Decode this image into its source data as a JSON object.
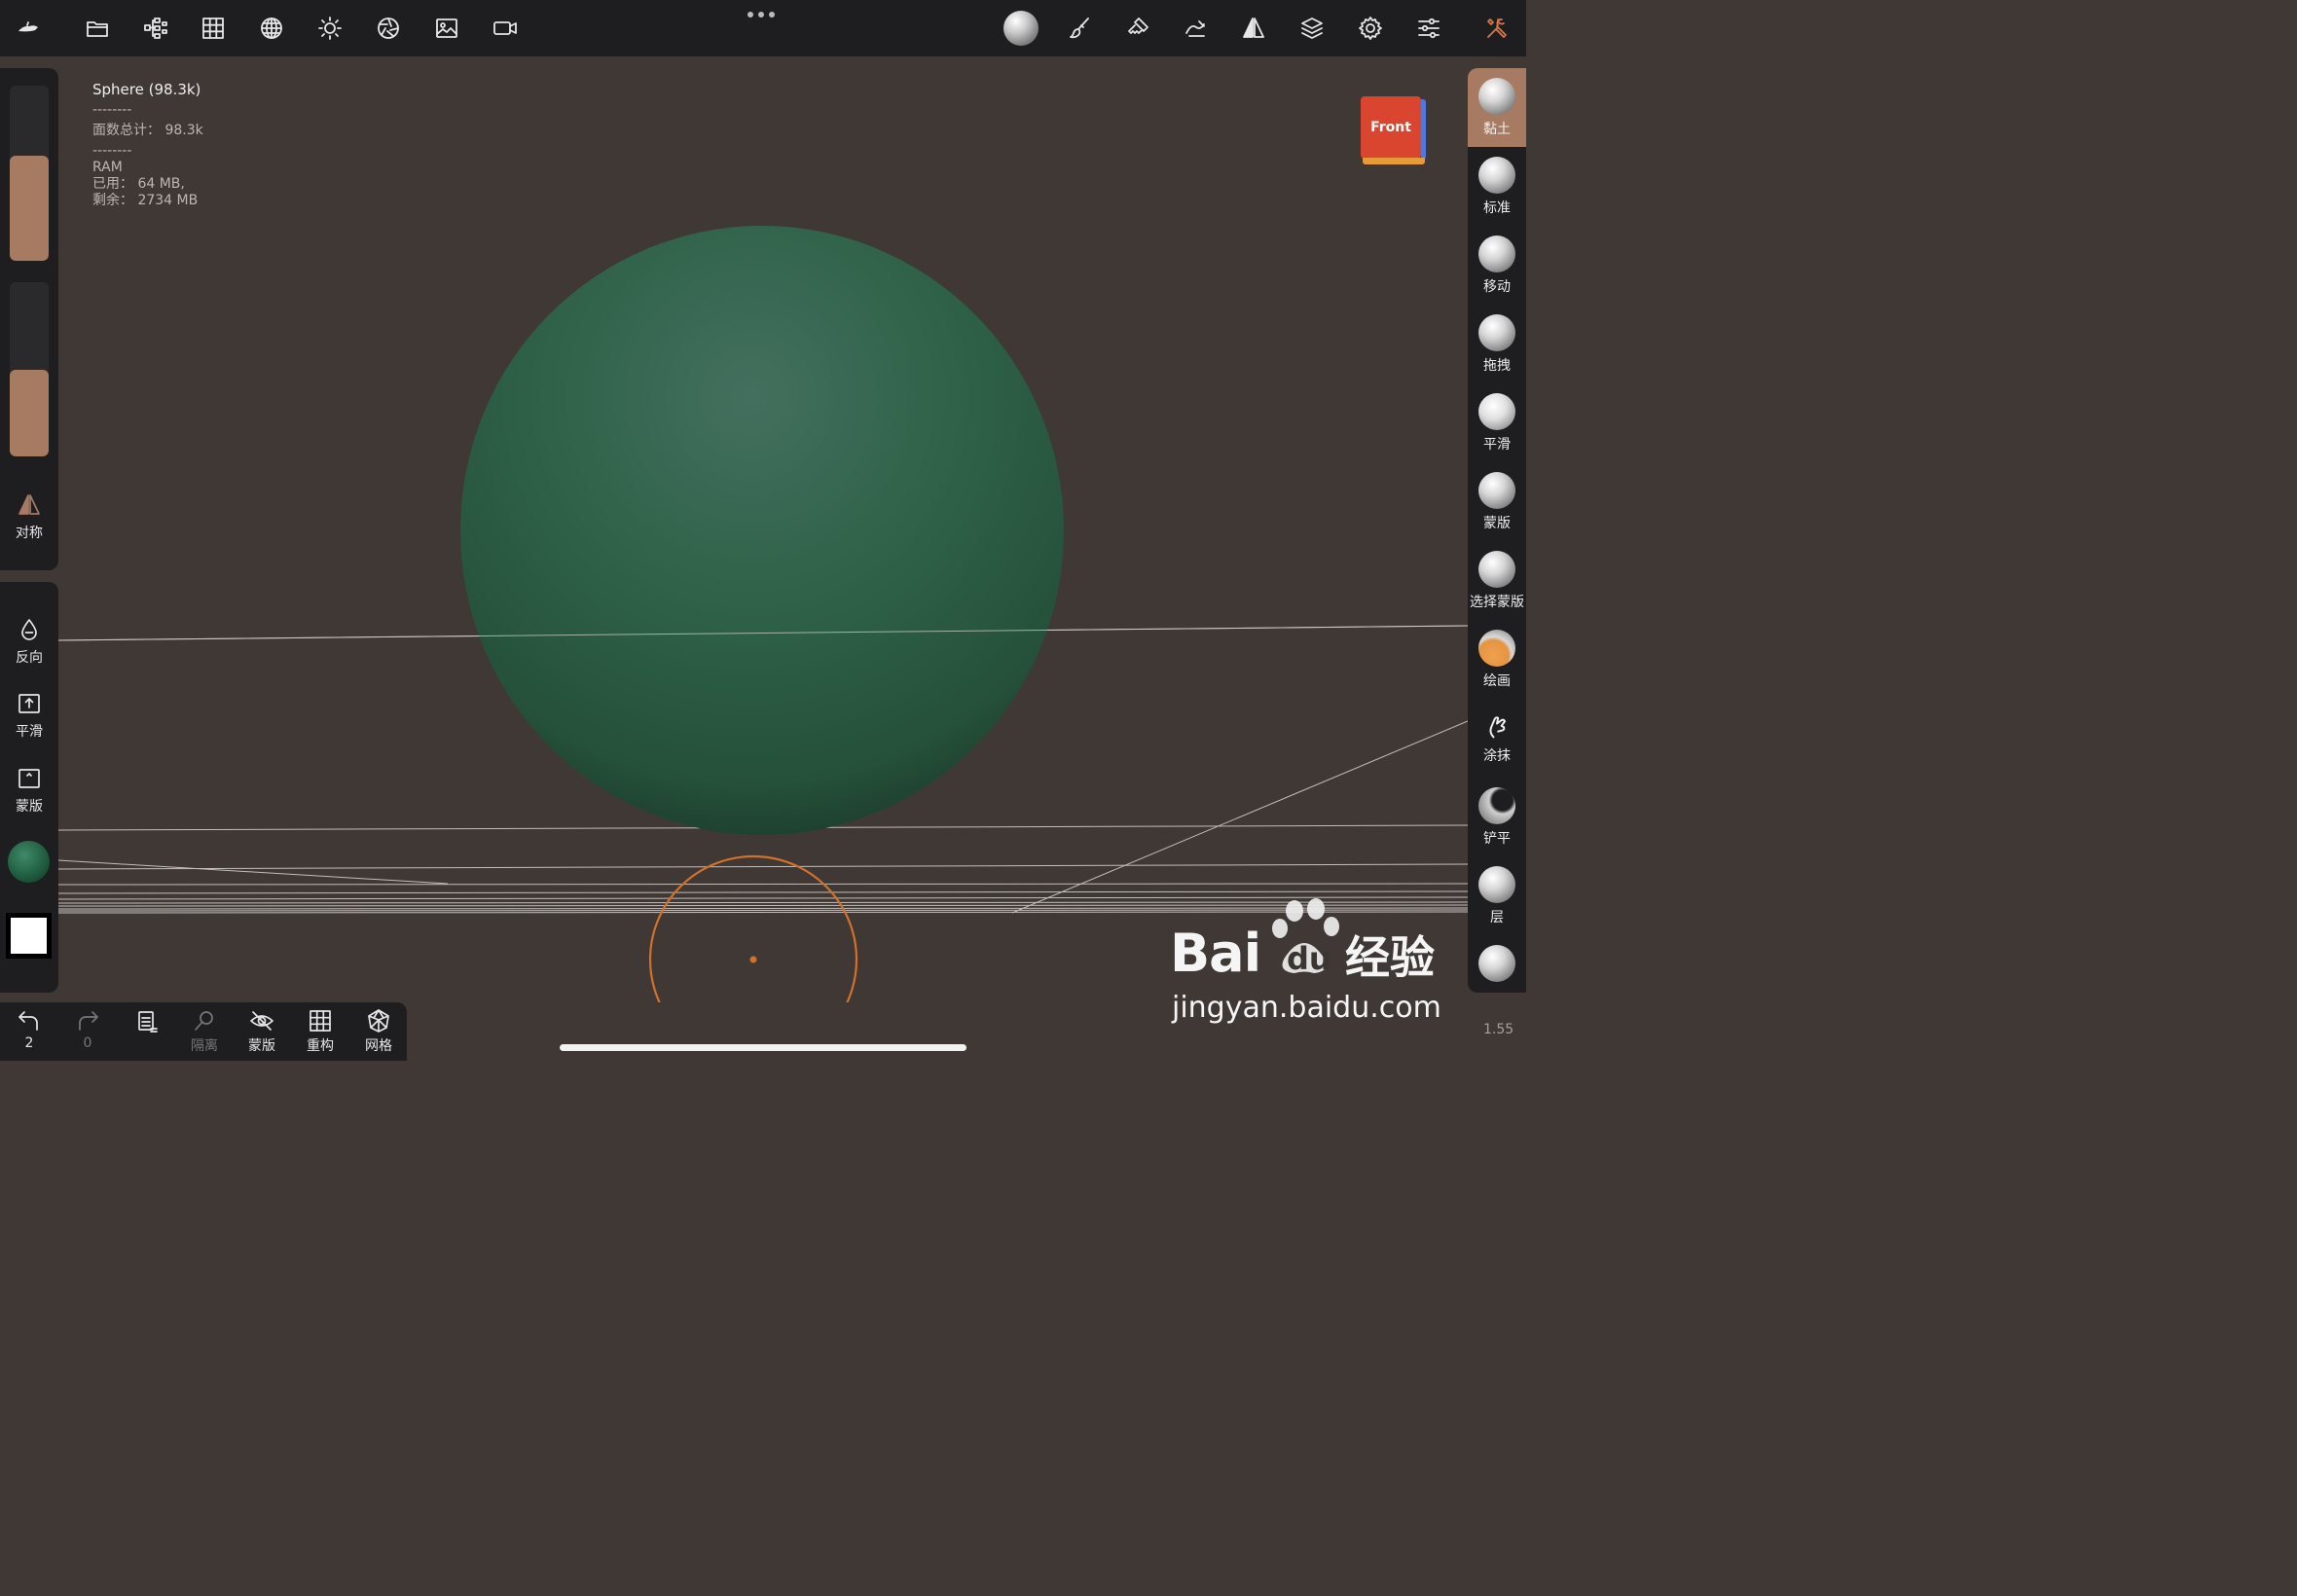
{
  "top_toolbar": {
    "icons": [
      "menu-logo-icon",
      "folder-icon",
      "scene-tree-icon",
      "grid-icon",
      "wireframe-globe-icon",
      "light-icon",
      "camera-aperture-icon",
      "image-icon",
      "video-icon"
    ],
    "right_icons": [
      "material-sphere-icon",
      "paint-brush-icon",
      "stamp-icon",
      "stroke-icon",
      "symmetry-icon",
      "layers-icon",
      "settings-gear-icon",
      "sliders-icon",
      "tools-icon"
    ]
  },
  "info": {
    "title": "Sphere (98.3k)",
    "sep1": "--------",
    "faces": "面数总计：  98.3k",
    "sep2": "--------",
    "ram": "RAM",
    "used": "已用：  64 MB,",
    "free": "剩余：  2734 MB"
  },
  "left_panel": {
    "radius_slider": 0.6,
    "intensity_slider": 0.5,
    "symmetry_label": "对称",
    "invert_label": "反向",
    "smooth_label": "平滑",
    "mask_label": "蒙版",
    "sculpt_color": "#1e5a3f",
    "secondary_color": "#ffffff"
  },
  "bottom_bar": {
    "undo_count": "2",
    "redo_count": "0",
    "isolate_label": "隔离",
    "mask_label": "蒙版",
    "remesh_label": "重构",
    "mesh_label": "网格"
  },
  "nav_cube": {
    "face_label": "Front"
  },
  "tools": [
    {
      "label": "黏土",
      "active": true
    },
    {
      "label": "标准"
    },
    {
      "label": "移动"
    },
    {
      "label": "拖拽"
    },
    {
      "label": "平滑"
    },
    {
      "label": "蒙版"
    },
    {
      "label": "选择蒙版"
    },
    {
      "label": "绘画"
    },
    {
      "label": "涂抹"
    },
    {
      "label": "铲平"
    },
    {
      "label": "层"
    },
    {
      "label": ""
    }
  ],
  "zoom_value": "1.55",
  "watermark": {
    "brand": "Bai",
    "brand2": "du",
    "cn": "经验",
    "url": "jingyan.baidu.com"
  },
  "colors": {
    "accent": "#a77a62",
    "brush_cursor": "#d1712a",
    "sphere": "#2a5f45"
  }
}
